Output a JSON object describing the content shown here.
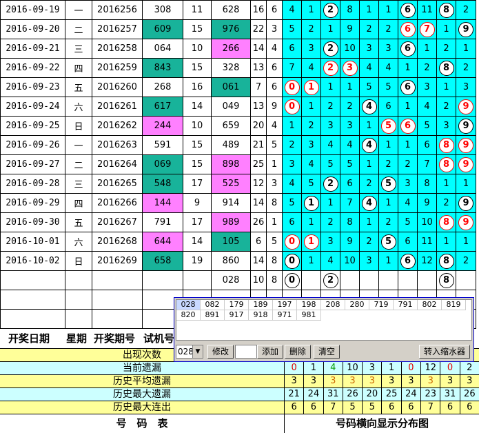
{
  "rows": [
    {
      "date": "2016-09-19",
      "wk": "一",
      "issue": "2016256",
      "a": "308",
      "s": "11",
      "b": "628",
      "c": "16",
      "d": "6",
      "ab": "",
      "bb": "",
      "m": [
        "4",
        "1",
        "2",
        "8",
        "1",
        "1",
        "6",
        "11",
        "8",
        "2"
      ],
      "balls": [
        2,
        6,
        8
      ],
      "red": []
    },
    {
      "date": "2016-09-20",
      "wk": "二",
      "issue": "2016257",
      "a": "609",
      "s": "15",
      "b": "976",
      "c": "22",
      "d": "3",
      "ab": "teal",
      "bb": "teal",
      "m": [
        "5",
        "2",
        "1",
        "9",
        "2",
        "2",
        "6",
        "7",
        "1",
        "9"
      ],
      "balls": [
        6,
        7,
        9
      ],
      "red": [
        6,
        7
      ]
    },
    {
      "date": "2016-09-21",
      "wk": "三",
      "issue": "2016258",
      "a": "064",
      "s": "10",
      "b": "266",
      "c": "14",
      "d": "4",
      "ab": "",
      "bb": "pink",
      "m": [
        "6",
        "3",
        "2",
        "10",
        "3",
        "3",
        "6",
        "1",
        "2",
        "1"
      ],
      "balls": [
        2,
        6
      ],
      "red": []
    },
    {
      "date": "2016-09-22",
      "wk": "四",
      "issue": "2016259",
      "a": "843",
      "s": "15",
      "b": "328",
      "c": "13",
      "d": "6",
      "ab": "teal",
      "bb": "",
      "m": [
        "7",
        "4",
        "2",
        "3",
        "4",
        "4",
        "1",
        "2",
        "8",
        "2"
      ],
      "balls": [
        2,
        3,
        8
      ],
      "red": [
        2,
        3
      ]
    },
    {
      "date": "2016-09-23",
      "wk": "五",
      "issue": "2016260",
      "a": "268",
      "s": "16",
      "b": "061",
      "c": "7",
      "d": "6",
      "ab": "",
      "bb": "teal",
      "m": [
        "0",
        "1",
        "1",
        "1",
        "5",
        "5",
        "6",
        "3",
        "1",
        "3"
      ],
      "balls": [
        0,
        1,
        6
      ],
      "red": [
        0,
        1
      ]
    },
    {
      "date": "2016-09-24",
      "wk": "六",
      "issue": "2016261",
      "a": "617",
      "s": "14",
      "b": "049",
      "c": "13",
      "d": "9",
      "ab": "teal",
      "bb": "",
      "m": [
        "0",
        "1",
        "2",
        "2",
        "4",
        "6",
        "1",
        "4",
        "2",
        "9"
      ],
      "balls": [
        0,
        4,
        9
      ],
      "red": [
        0,
        9
      ]
    },
    {
      "date": "2016-09-25",
      "wk": "日",
      "issue": "2016262",
      "a": "244",
      "s": "10",
      "b": "659",
      "c": "20",
      "d": "4",
      "ab": "pink",
      "bb": "",
      "m": [
        "1",
        "2",
        "3",
        "3",
        "1",
        "5",
        "6",
        "5",
        "3",
        "9"
      ],
      "balls": [
        5,
        6,
        9
      ],
      "red": [
        5,
        6
      ]
    },
    {
      "date": "2016-09-26",
      "wk": "一",
      "issue": "2016263",
      "a": "591",
      "s": "15",
      "b": "489",
      "c": "21",
      "d": "5",
      "ab": "",
      "bb": "",
      "m": [
        "2",
        "3",
        "4",
        "4",
        "4",
        "1",
        "1",
        "6",
        "8",
        "9"
      ],
      "balls": [
        4,
        8,
        9
      ],
      "red": [
        8,
        9
      ]
    },
    {
      "date": "2016-09-27",
      "wk": "二",
      "issue": "2016264",
      "a": "069",
      "s": "15",
      "b": "898",
      "c": "25",
      "d": "1",
      "ab": "teal",
      "bb": "pink",
      "m": [
        "3",
        "4",
        "5",
        "5",
        "1",
        "2",
        "2",
        "7",
        "8",
        "9"
      ],
      "balls": [
        8,
        9
      ],
      "red": [
        8,
        9
      ]
    },
    {
      "date": "2016-09-28",
      "wk": "三",
      "issue": "2016265",
      "a": "548",
      "s": "17",
      "b": "525",
      "c": "12",
      "d": "3",
      "ab": "teal",
      "bb": "pink",
      "m": [
        "4",
        "5",
        "2",
        "6",
        "2",
        "5",
        "3",
        "8",
        "1",
        "1"
      ],
      "balls": [
        2,
        5
      ],
      "red": []
    },
    {
      "date": "2016-09-29",
      "wk": "四",
      "issue": "2016266",
      "a": "144",
      "s": "9",
      "b": "914",
      "c": "14",
      "d": "8",
      "ab": "pink",
      "bb": "",
      "m": [
        "5",
        "1",
        "1",
        "7",
        "4",
        "1",
        "4",
        "9",
        "2",
        "9"
      ],
      "balls": [
        1,
        4,
        9
      ],
      "red": []
    },
    {
      "date": "2016-09-30",
      "wk": "五",
      "issue": "2016267",
      "a": "791",
      "s": "17",
      "b": "989",
      "c": "26",
      "d": "1",
      "ab": "",
      "bb": "pink",
      "m": [
        "6",
        "1",
        "2",
        "8",
        "1",
        "2",
        "5",
        "10",
        "8",
        "9"
      ],
      "balls": [
        8,
        9
      ],
      "red": [
        8,
        9
      ]
    },
    {
      "date": "2016-10-01",
      "wk": "六",
      "issue": "2016268",
      "a": "644",
      "s": "14",
      "b": "105",
      "c": "6",
      "d": "5",
      "ab": "pink",
      "bb": "teal",
      "m": [
        "0",
        "1",
        "3",
        "9",
        "2",
        "5",
        "6",
        "11",
        "1",
        "1"
      ],
      "balls": [
        0,
        1,
        5
      ],
      "red": [
        0,
        1
      ]
    },
    {
      "date": "2016-10-02",
      "wk": "日",
      "issue": "2016269",
      "a": "658",
      "s": "19",
      "b": "860",
      "c": "14",
      "d": "8",
      "ab": "teal",
      "bb": "",
      "m": [
        "0",
        "1",
        "4",
        "10",
        "3",
        "1",
        "6",
        "12",
        "8",
        "2"
      ],
      "balls": [
        0,
        6,
        8
      ],
      "red": []
    }
  ],
  "trial": {
    "b": "028",
    "c": "10",
    "d": "8",
    "balls": [
      "0",
      "2",
      "8"
    ]
  },
  "headers": {
    "date": "开奖日期",
    "wk": "星期",
    "issue": "开奖期号",
    "trial": "试机号"
  },
  "stats": [
    {
      "label": "出现次数",
      "vals": []
    },
    {
      "label": "当前遗漏",
      "vals": [
        "0",
        "1",
        "4",
        "10",
        "3",
        "1",
        "0",
        "12",
        "0",
        "2"
      ]
    },
    {
      "label": "历史平均遗漏",
      "vals": [
        "3",
        "3",
        "3",
        "3",
        "3",
        "3",
        "3",
        "3",
        "3",
        "3"
      ]
    },
    {
      "label": "历史最大遗漏",
      "vals": [
        "21",
        "24",
        "31",
        "26",
        "20",
        "25",
        "24",
        "23",
        "31",
        "26"
      ]
    },
    {
      "label": "历史最大连出",
      "vals": [
        "6",
        "6",
        "7",
        "5",
        "5",
        "6",
        "6",
        "7",
        "6",
        "6"
      ]
    }
  ],
  "footer": {
    "left": "号　码　表",
    "right": "号码横向显示分布图"
  },
  "popup": {
    "items": [
      "028",
      "082",
      "179",
      "189",
      "197",
      "198",
      "208",
      "280",
      "719",
      "791",
      "802",
      "819",
      "820",
      "891",
      "917",
      "918",
      "971",
      "981"
    ],
    "select": "028",
    "btn_modify": "修改",
    "btn_add": "添加",
    "btn_delete": "删除",
    "btn_clear": "清空",
    "btn_transfer": "转入缩水器"
  },
  "colors": {
    "teal": "#18b39a",
    "pink": "#ff80ff",
    "cyan": "#00ffff",
    "red": "#ff0000"
  }
}
